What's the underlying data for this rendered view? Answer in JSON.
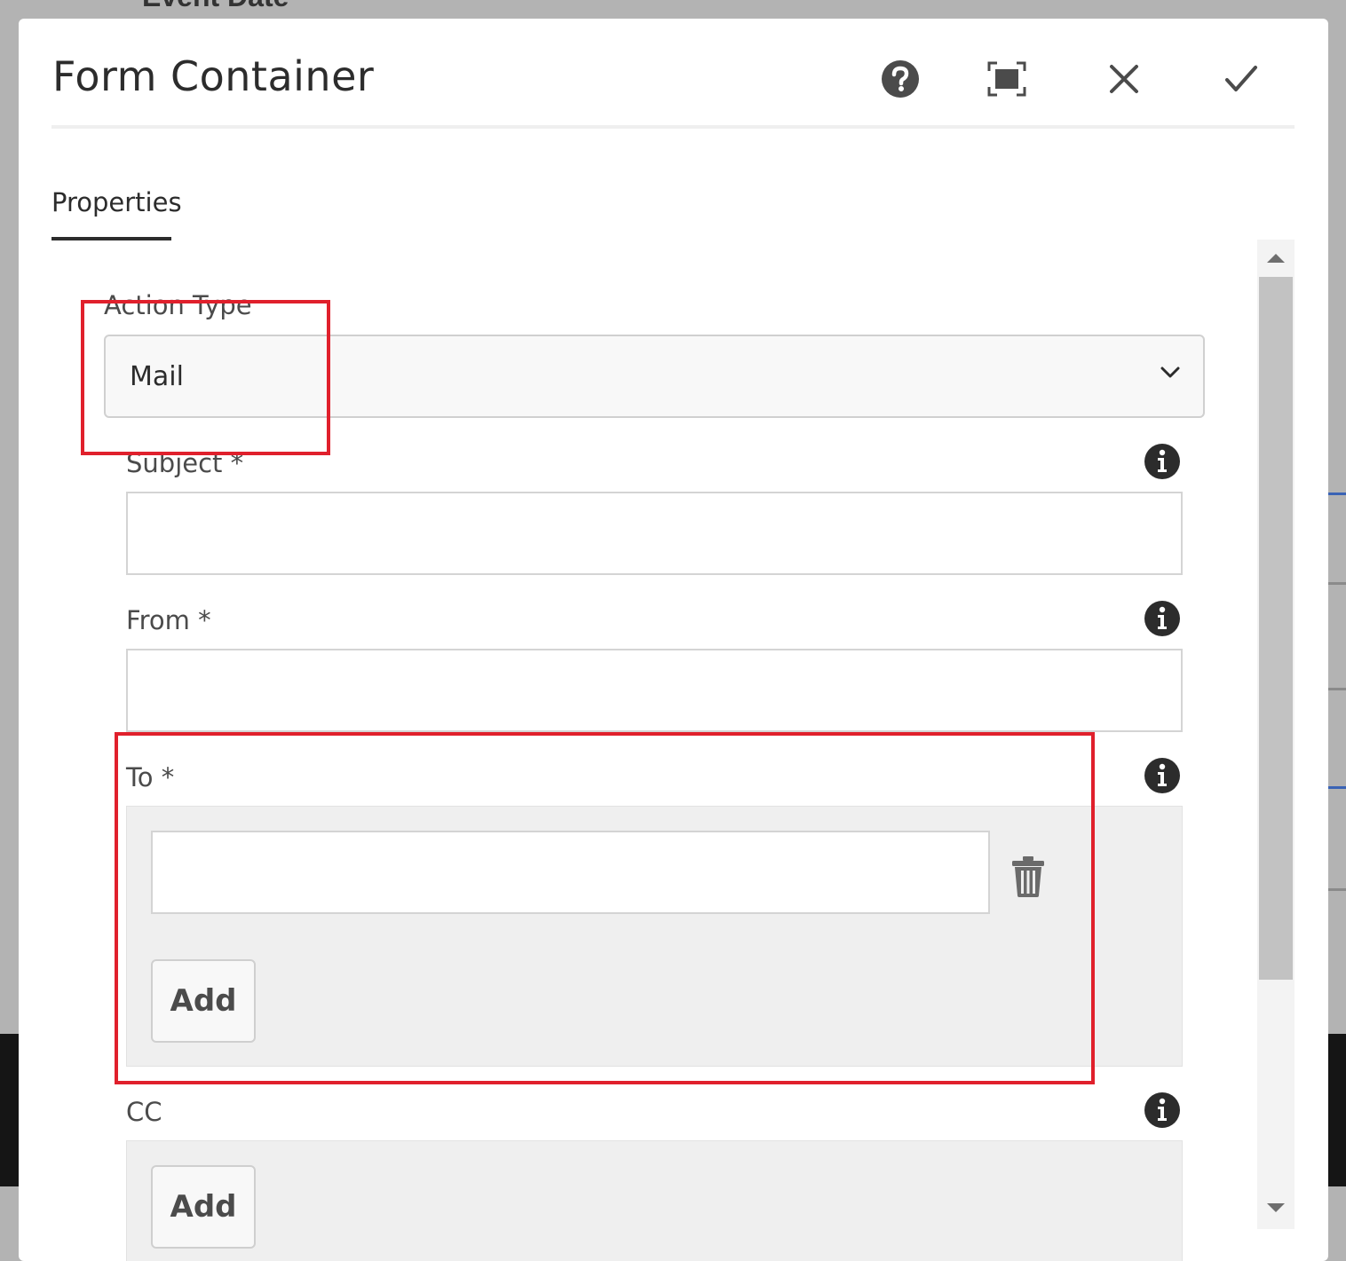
{
  "background": {
    "heading": "Event Date"
  },
  "dialog": {
    "title": "Form Container",
    "header_icons": [
      "help-icon",
      "fullscreen-icon",
      "close-icon",
      "confirm-icon"
    ]
  },
  "tabs": [
    {
      "label": "Properties",
      "active": true
    }
  ],
  "form": {
    "action_type": {
      "label": "Action Type",
      "value": "Mail"
    },
    "subject": {
      "label": "Subject *",
      "value": ""
    },
    "from": {
      "label": "From *",
      "value": ""
    },
    "to": {
      "label": "To *",
      "items": [
        ""
      ],
      "add_label": "Add"
    },
    "cc": {
      "label": "CC",
      "add_label": "Add"
    }
  },
  "colors": {
    "highlight": "#e0202c",
    "accent_line": "#3a63b5"
  }
}
